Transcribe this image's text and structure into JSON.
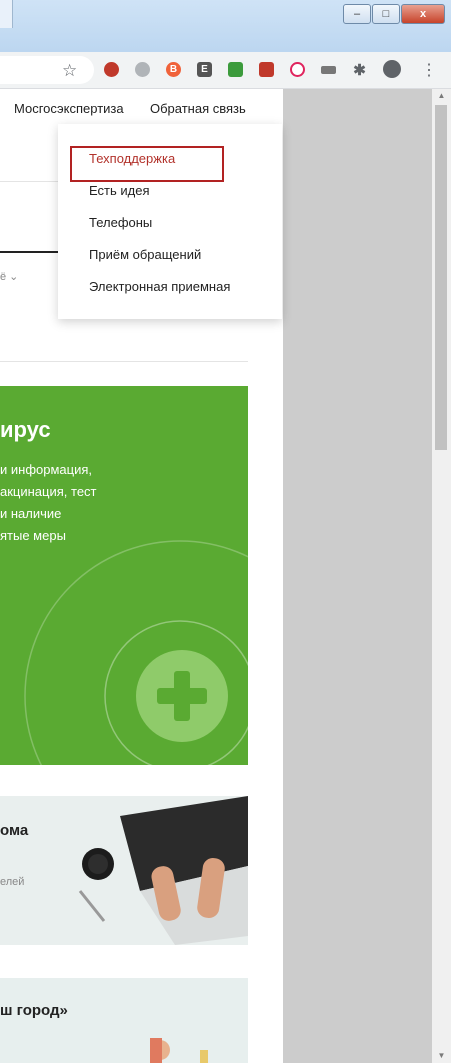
{
  "browser": {
    "window_buttons": {
      "minimize": "–",
      "maximize": "□",
      "close": "x"
    },
    "star_icon": "star-icon",
    "menu_icon": "⋮"
  },
  "nav": {
    "items": [
      {
        "label": "Мосгосэкспертиза"
      },
      {
        "label": "Обратная связь"
      }
    ]
  },
  "dropdown": {
    "items": [
      {
        "label": "Техподдержка",
        "active": true
      },
      {
        "label": "Есть идея"
      },
      {
        "label": "Телефоны"
      },
      {
        "label": "Приём обращений"
      },
      {
        "label": "Электронная приемная"
      }
    ]
  },
  "filter": {
    "label": "ё ⌄"
  },
  "cards": {
    "green": {
      "title": "ирус",
      "lines": [
        "и информация,",
        "акцинация, тест",
        "и наличие",
        "ятые меры"
      ]
    },
    "card2": {
      "title": "ома",
      "sub": "елей"
    },
    "card3": {
      "title": "ш город»"
    }
  },
  "colors": {
    "green": "#5aaa32",
    "accent_red": "#b2322b"
  }
}
